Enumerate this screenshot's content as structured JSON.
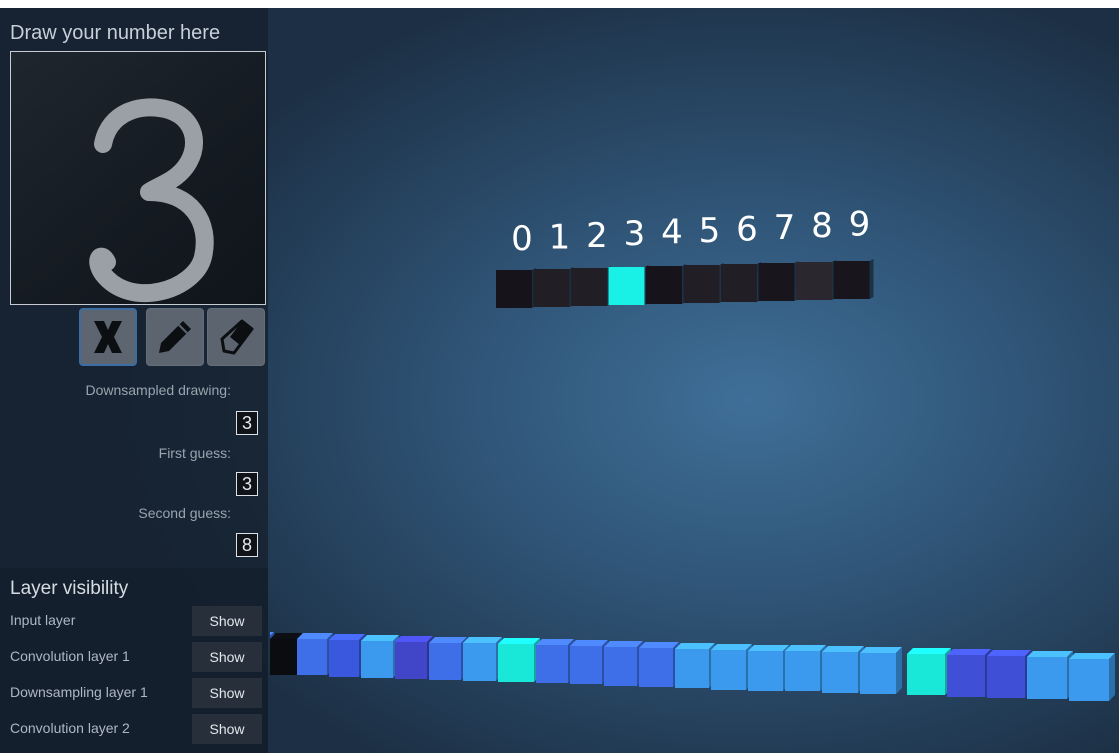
{
  "canvas_panel": {
    "title": "Draw your number here",
    "drawn_digit": "3"
  },
  "tools": {
    "clear": "clear-icon",
    "pencil": "pencil-icon",
    "eraser": "eraser-icon"
  },
  "results": {
    "downsampled_label": "Downsampled drawing:",
    "downsampled_value": "3",
    "first_guess_label": "First guess:",
    "first_guess_value": "3",
    "second_guess_label": "Second guess:",
    "second_guess_value": "8"
  },
  "output_layer": {
    "labels": [
      "0",
      "1",
      "2",
      "3",
      "4",
      "5",
      "6",
      "7",
      "8",
      "9"
    ],
    "activations": [
      0.05,
      0.18,
      0.18,
      1.0,
      0.05,
      0.18,
      0.18,
      0.08,
      0.28,
      0.08
    ],
    "highlight_color": "#19f0e6"
  },
  "layer_visibility": {
    "title": "Layer visibility",
    "layers": [
      {
        "name": "Input layer",
        "button": "Show"
      },
      {
        "name": "Convolution layer 1",
        "button": "Show"
      },
      {
        "name": "Downsampling layer 1",
        "button": "Show"
      },
      {
        "name": "Convolution layer 2",
        "button": "Show"
      }
    ]
  },
  "colors": {
    "conv_cube_blue": "#3f6fe8",
    "conv_cube_light": "#3c9aee",
    "active_cube": "#19e8d8"
  }
}
